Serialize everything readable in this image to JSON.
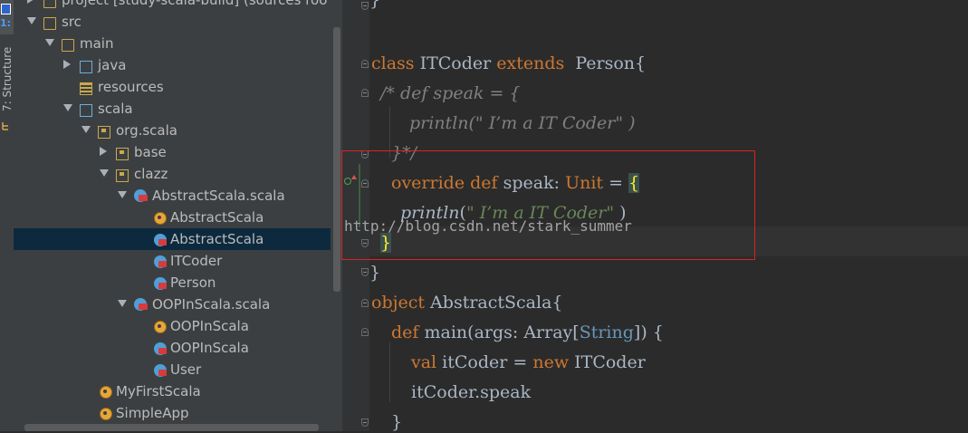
{
  "tool_strip": {
    "tab_label": "1:",
    "structure_label": "7: Structure"
  },
  "tree": {
    "items": [
      {
        "label": "project [study-scala-build] (sources roo",
        "icon": "folder-icon"
      },
      {
        "label": "src",
        "icon": "folder-icon"
      },
      {
        "label": "main",
        "icon": "folder-icon"
      },
      {
        "label": "java",
        "icon": "source-folder-icon"
      },
      {
        "label": "resources",
        "icon": "resources-folder-icon"
      },
      {
        "label": "scala",
        "icon": "source-folder-icon"
      },
      {
        "label": "org.scala",
        "icon": "package-icon"
      },
      {
        "label": "base",
        "icon": "package-icon"
      },
      {
        "label": "clazz",
        "icon": "package-icon"
      },
      {
        "label": "AbstractScala.scala",
        "icon": "scala-file-icon"
      },
      {
        "label": "AbstractScala",
        "icon": "object-icon"
      },
      {
        "label": "AbstractScala",
        "icon": "class-icon"
      },
      {
        "label": "ITCoder",
        "icon": "class-icon"
      },
      {
        "label": "Person",
        "icon": "class-icon"
      },
      {
        "label": "OOPInScala.scala",
        "icon": "scala-file-icon"
      },
      {
        "label": "OOPInScala",
        "icon": "object-icon"
      },
      {
        "label": "OOPInScala",
        "icon": "class-icon"
      },
      {
        "label": "User",
        "icon": "class-icon"
      },
      {
        "label": "MyFirstScala",
        "icon": "object-icon"
      },
      {
        "label": "SimpleApp",
        "icon": "object-icon"
      }
    ],
    "selected_item": "AbstractScala"
  },
  "editor": {
    "lines": {
      "l0": "}",
      "l1_kw1": "class",
      "l1_name": " ITCoder ",
      "l1_kw2": "extends",
      "l1_rest": "  Person{",
      "l2": "/* def speak = {",
      "l3": "println(\" I’m a IT Coder\" )",
      "l4": "}*/",
      "l5_kw1": "override",
      "l5_kw2": "def",
      "l5_name": "speak: ",
      "l5_type": "Unit",
      "l5_eq": " = ",
      "l5_brace": "{",
      "l6_fn": "println",
      "l6_open": "(",
      "l6_str": "\" I’m a IT Coder\"",
      "l6_close": " )",
      "l7": "}",
      "l8": "}",
      "l9_kw": "object",
      "l9_rest": " AbstractScala{",
      "l10_kw": "def",
      "l10_a": " main(args: Array[",
      "l10_type": "String",
      "l10_b": "]) {",
      "l11_kw1": "val",
      "l11_a": " itCoder = ",
      "l11_kw2": "new",
      "l11_b": " ITCoder",
      "l12": "itCoder.speak",
      "l13": "}"
    },
    "watermark": "http://blog.csdn.net/stark_summer"
  },
  "colors": {
    "keyword": "#cc7832",
    "comment": "#808080",
    "string": "#6a8759",
    "type": "#6897bb",
    "selection": "#0d293e",
    "highlight_border": "#e02020"
  }
}
